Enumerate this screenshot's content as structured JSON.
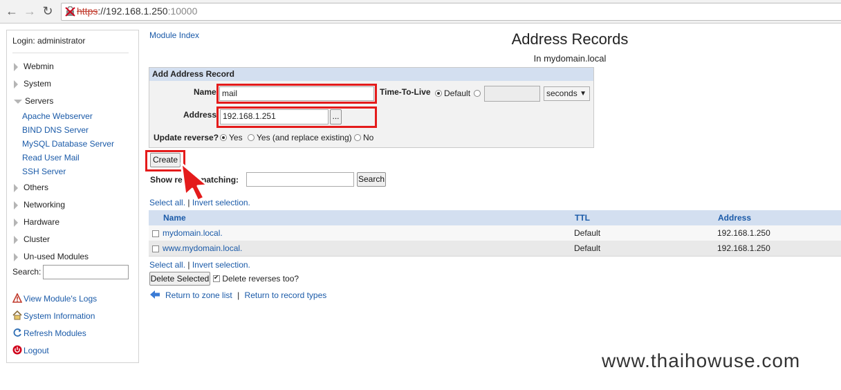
{
  "browser": {
    "url_scheme": "https",
    "url_host": "://192.168.1.250",
    "url_port": ":10000"
  },
  "sidebar": {
    "login": "Login: administrator",
    "categories": {
      "webmin": "Webmin",
      "system": "System",
      "servers": "Servers",
      "others": "Others",
      "networking": "Networking",
      "hardware": "Hardware",
      "cluster": "Cluster",
      "unused": "Un-used Modules"
    },
    "servers_items": [
      "Apache Webserver",
      "BIND DNS Server",
      "MySQL Database Server",
      "Read User Mail",
      "SSH Server"
    ],
    "search_label": "Search:",
    "links": [
      "View Module's Logs",
      "System Information",
      "Refresh Modules",
      "Logout"
    ]
  },
  "main": {
    "module_index": "Module Index",
    "title": "Address Records",
    "subtitle": "In mydomain.local",
    "form": {
      "header": "Add Address Record",
      "name_label": "Name",
      "name_value": "mail",
      "ttl_label": "Time-To-Live",
      "ttl_default": "Default",
      "ttl_unit": "seconds",
      "address_label": "Address",
      "address_value": "192.168.1.251",
      "browse_label": "...",
      "reverse_label": "Update reverse?",
      "reverse_options": [
        "Yes",
        "Yes (and replace existing)",
        "No"
      ]
    },
    "create_button": "Create",
    "show_label_pre": "Show re",
    "show_label_post": "matching:",
    "search_button": "Search",
    "select_all": "Select all.",
    "separator": "|",
    "invert_selection": "Invert selection.",
    "table": {
      "headers": [
        "Name",
        "TTL",
        "Address"
      ],
      "rows": [
        {
          "name": "mydomain.local.",
          "ttl": "Default",
          "address": "192.168.1.250"
        },
        {
          "name": "www.mydomain.local.",
          "ttl": "Default",
          "address": "192.168.1.250"
        }
      ]
    },
    "delete_button": "Delete Selected",
    "delete_reverses": "Delete reverses too?",
    "return_zone": "Return to zone list",
    "return_sep": "|",
    "return_types": "Return to record types"
  },
  "watermark": "www.thaihowuse.com",
  "colors": {
    "accent": "#e41b1b",
    "link": "#1a5aa8",
    "header_bg": "#d3dff0"
  }
}
